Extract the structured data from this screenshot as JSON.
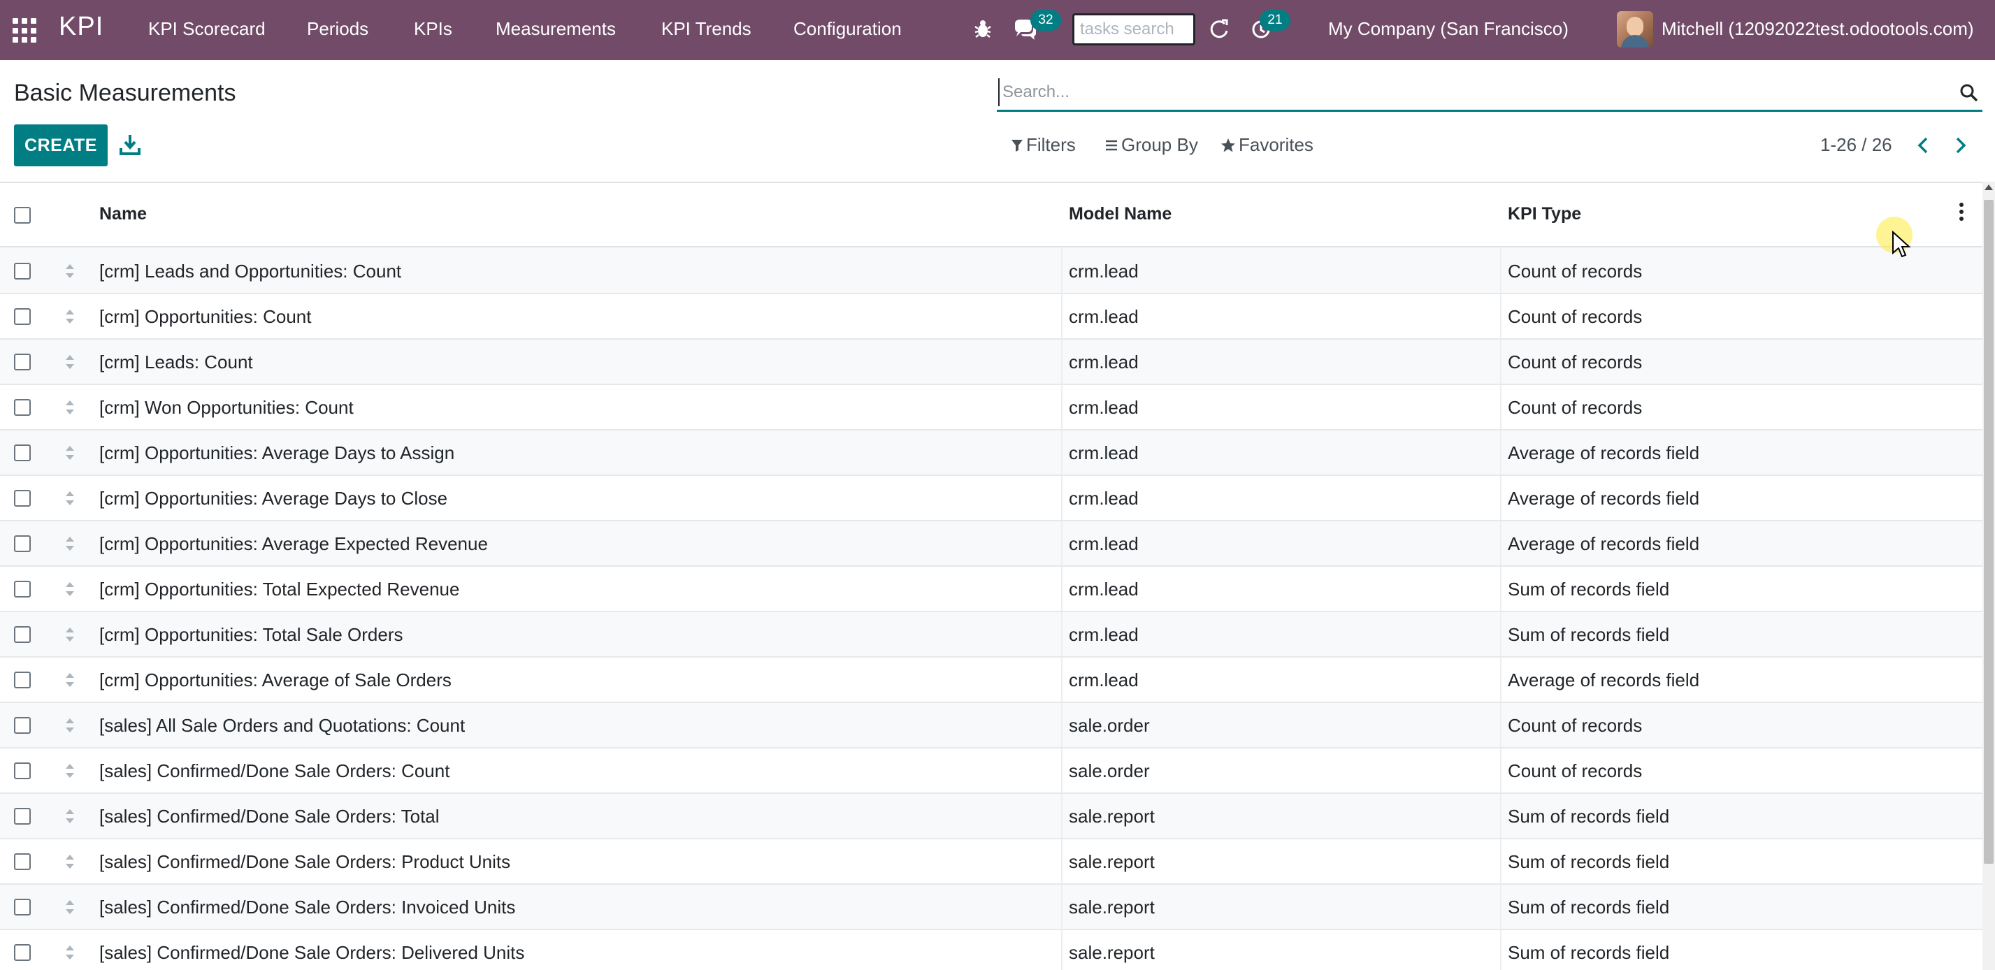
{
  "navbar": {
    "brand": "KPI",
    "menu": [
      "KPI Scorecard",
      "Periods",
      "KPIs",
      "Measurements",
      "KPI Trends",
      "Configuration"
    ],
    "messages_count": "32",
    "activities_count": "21",
    "tasks_search_placeholder": "tasks search",
    "company": "My Company (San Francisco)",
    "user": "Mitchell (12092022test.odootools.com)",
    "bg_color": "#714b67"
  },
  "control_panel": {
    "title": "Basic Measurements",
    "search_placeholder": "Search...",
    "create_label": "CREATE",
    "filters_label": "Filters",
    "group_by_label": "Group By",
    "favorites_label": "Favorites",
    "pager": "1-26 / 26",
    "accent_color": "#017e84"
  },
  "table": {
    "columns": {
      "name": "Name",
      "model": "Model Name",
      "kpi_type": "KPI Type"
    },
    "rows": [
      {
        "name": "[crm] Leads and Opportunities: Count",
        "model": "crm.lead",
        "kpi_type": "Count of records"
      },
      {
        "name": "[crm] Opportunities: Count",
        "model": "crm.lead",
        "kpi_type": "Count of records"
      },
      {
        "name": "[crm] Leads: Count",
        "model": "crm.lead",
        "kpi_type": "Count of records"
      },
      {
        "name": "[crm] Won Opportunities: Count",
        "model": "crm.lead",
        "kpi_type": "Count of records"
      },
      {
        "name": "[crm] Opportunities: Average Days to Assign",
        "model": "crm.lead",
        "kpi_type": "Average of records field"
      },
      {
        "name": "[crm] Opportunities: Average Days to Close",
        "model": "crm.lead",
        "kpi_type": "Average of records field"
      },
      {
        "name": "[crm] Opportunities: Average Expected Revenue",
        "model": "crm.lead",
        "kpi_type": "Average of records field"
      },
      {
        "name": "[crm] Opportunities: Total Expected Revenue",
        "model": "crm.lead",
        "kpi_type": "Sum of records field"
      },
      {
        "name": "[crm] Opportunities: Total Sale Orders",
        "model": "crm.lead",
        "kpi_type": "Sum of records field"
      },
      {
        "name": "[crm] Opportunities: Average of Sale Orders",
        "model": "crm.lead",
        "kpi_type": "Average of records field"
      },
      {
        "name": "[sales] All Sale Orders and Quotations: Count",
        "model": "sale.order",
        "kpi_type": "Count of records"
      },
      {
        "name": "[sales] Confirmed/Done Sale Orders: Count",
        "model": "sale.order",
        "kpi_type": "Count of records"
      },
      {
        "name": "[sales] Confirmed/Done Sale Orders: Total",
        "model": "sale.report",
        "kpi_type": "Sum of records field"
      },
      {
        "name": "[sales] Confirmed/Done Sale Orders: Product Units",
        "model": "sale.report",
        "kpi_type": "Sum of records field"
      },
      {
        "name": "[sales] Confirmed/Done Sale Orders: Invoiced Units",
        "model": "sale.report",
        "kpi_type": "Sum of records field"
      },
      {
        "name": "[sales] Confirmed/Done Sale Orders: Delivered Units",
        "model": "sale.report",
        "kpi_type": "Sum of records field"
      }
    ]
  }
}
